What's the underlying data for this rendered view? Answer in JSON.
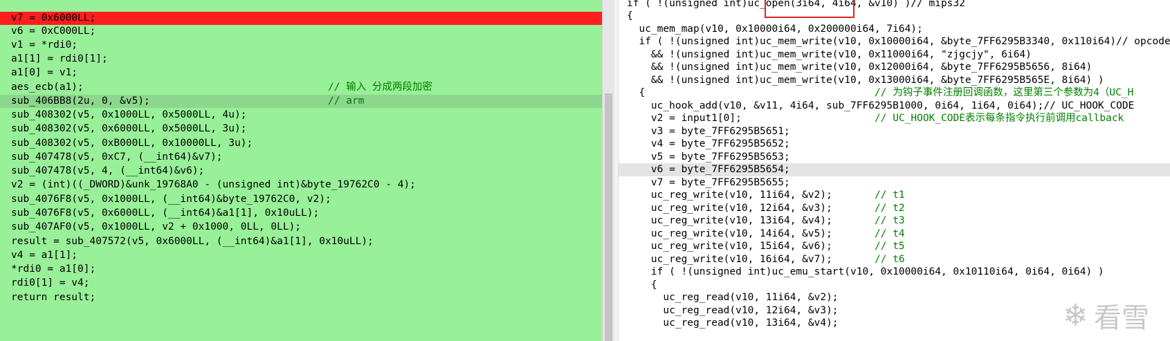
{
  "left_pane": {
    "lines": [
      "v7 = 0x6000LL;",
      "v6 = 0xC000LL;",
      "v1 = *rdi0;",
      "a1[1] = rdi0[1];",
      "a1[0] = v1;",
      "aes_ecb(a1);",
      "sub_406BB8(2u, 0, &v5);",
      "sub_408302(v5, 0x1000LL, 0x5000LL, 4u);",
      "sub_408302(v5, 0x6000LL, 0x5000LL, 3u);",
      "sub_408302(v5, 0xB000LL, 0x10000LL, 3u);",
      "sub_407478(v5, 0xC7, (__int64)&v7);",
      "sub_407478(v5, 4, (__int64)&v6);",
      "v2 = (int)((_DWORD)&unk_19768A0 - (unsigned int)&byte_19762C0 - 4);",
      "sub_4076F8(v5, 0x1000LL, (__int64)&byte_19762C0, v2);",
      "sub_4076F8(v5, 0x6000LL, (__int64)&a1[1], 0x10uLL);",
      "sub_407AF0(v5, 0x1000LL, v2 + 0x1000, 0LL, 0LL);",
      "result = sub_407572(v5, 0x6000LL, (__int64)&a1[1], 0x10uLL);",
      "v4 = a1[1];",
      "*rdi0 = a1[0];",
      "rdi0[1] = v4;",
      "return result;"
    ],
    "comment_aes": "// 输入 分成两段加密",
    "comment_arm": "// arm"
  },
  "right_pane": {
    "lines": [
      "if ( !(unsigned int)uc_open(3i64, 4i64, &v10) )// mips32",
      "{",
      "  uc_mem_map(v10, 0x10000i64, 0x200000i64, 7i64);",
      "  if ( !(unsigned int)uc_mem_write(v10, 0x10000i64, &byte_7FF6295B3340, 0x110i64)// opcode",
      "    && !(unsigned int)uc_mem_write(v10, 0x11000i64, \"zjgcjy\", 6i64)",
      "    && !(unsigned int)uc_mem_write(v10, 0x12000i64, &byte_7FF6295B5656, 8i64)",
      "    && !(unsigned int)uc_mem_write(v10, 0x13000i64, &byte_7FF6295B565E, 8i64) )",
      "  {",
      "    uc_hook_add(v10, &v11, 4i64, sub_7FF6295B1000, 0i64, 1i64, 0i64);// UC_HOOK_CODE",
      "    v2 = input1[0];",
      "    v3 = byte_7FF6295B5651;",
      "    v4 = byte_7FF6295B5652;",
      "    v5 = byte_7FF6295B5653;",
      "    v6 = byte_7FF6295B5654;",
      "    v7 = byte_7FF6295B5655;",
      "    uc_reg_write(v10, 11i64, &v2);",
      "    uc_reg_write(v10, 12i64, &v3);",
      "    uc_reg_write(v10, 13i64, &v4);",
      "    uc_reg_write(v10, 14i64, &v5);",
      "    uc_reg_write(v10, 15i64, &v6);",
      "    uc_reg_write(v10, 16i64, &v7);",
      "    if ( !(unsigned int)uc_emu_start(v10, 0x10000i64, 0x10110i64, 0i64, 0i64) )",
      "    {",
      "      uc_reg_read(v10, 11i64, &v2);",
      "      uc_reg_read(v10, 12i64, &v3);",
      "      uc_reg_read(v10, 13i64, &v4);"
    ],
    "comment_hook": "// 为钩子事件注册回调函数，这里第三个参数为4（UC_H",
    "comment_hook2": "// UC_HOOK_CODE表示每条指令执行前调用callback",
    "reg_comments": [
      "// t1",
      "// t2",
      "// t3",
      "// t4",
      "// t5",
      "// t6"
    ]
  },
  "watermark": {
    "icon": "snowflake-icon",
    "text": "看雪"
  },
  "colors": {
    "pane_bg": "#98f098",
    "line_highlight": "#ff1e1e",
    "current_line": "#8dd68d"
  }
}
